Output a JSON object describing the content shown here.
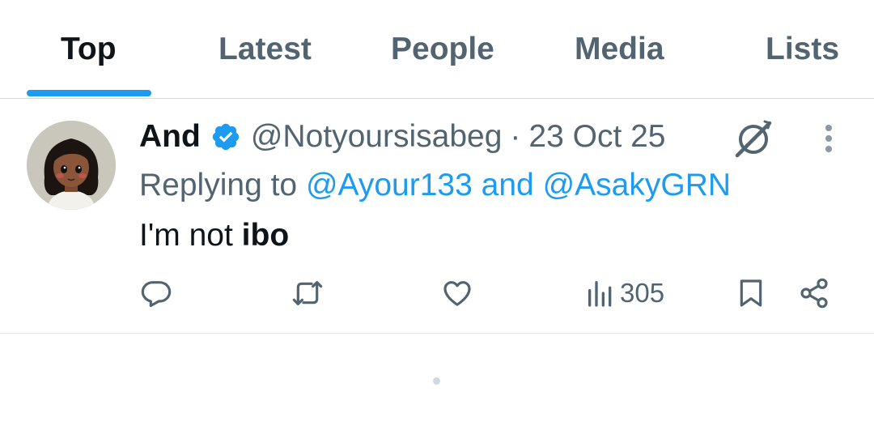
{
  "tabs": [
    {
      "label": "Top",
      "active": true
    },
    {
      "label": "Latest",
      "active": false
    },
    {
      "label": "People",
      "active": false
    },
    {
      "label": "Media",
      "active": false
    },
    {
      "label": "Lists",
      "active": false
    }
  ],
  "tweet": {
    "display_name": "And",
    "handle": "@Notyoursisabeg",
    "separator": "·",
    "date": "23 Oct 25",
    "reply_prefix": "Replying to",
    "reply_user1": "@Ayour133",
    "reply_and": "and",
    "reply_user2": "@AsakyGRN",
    "text_plain": "I'm not",
    "text_bold": "ibo",
    "views": "305"
  },
  "colors": {
    "accent": "#1d9bf0",
    "text_primary": "#0f1419",
    "text_secondary": "#536471",
    "divider": "#e1e8ed"
  },
  "icons": {
    "verified": "verified-badge-icon",
    "grok": "grok-icon",
    "more": "more-vertical-icon",
    "reply": "reply-icon",
    "retweet": "retweet-icon",
    "like": "heart-icon",
    "views": "views-chart-icon",
    "bookmark": "bookmark-icon",
    "share": "share-icon"
  }
}
